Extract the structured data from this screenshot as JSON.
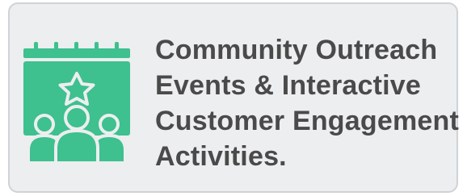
{
  "card": {
    "lines": [
      "Community Outreach",
      "Events & Interactive",
      "Customer Engagement",
      "Activities."
    ]
  },
  "icon": {
    "name": "calendar-star-people-icon",
    "color": "#3ec08f"
  },
  "colors": {
    "card_background": "#eceef0",
    "card_border": "#cfd3d7",
    "text": "#4a4a4a"
  }
}
